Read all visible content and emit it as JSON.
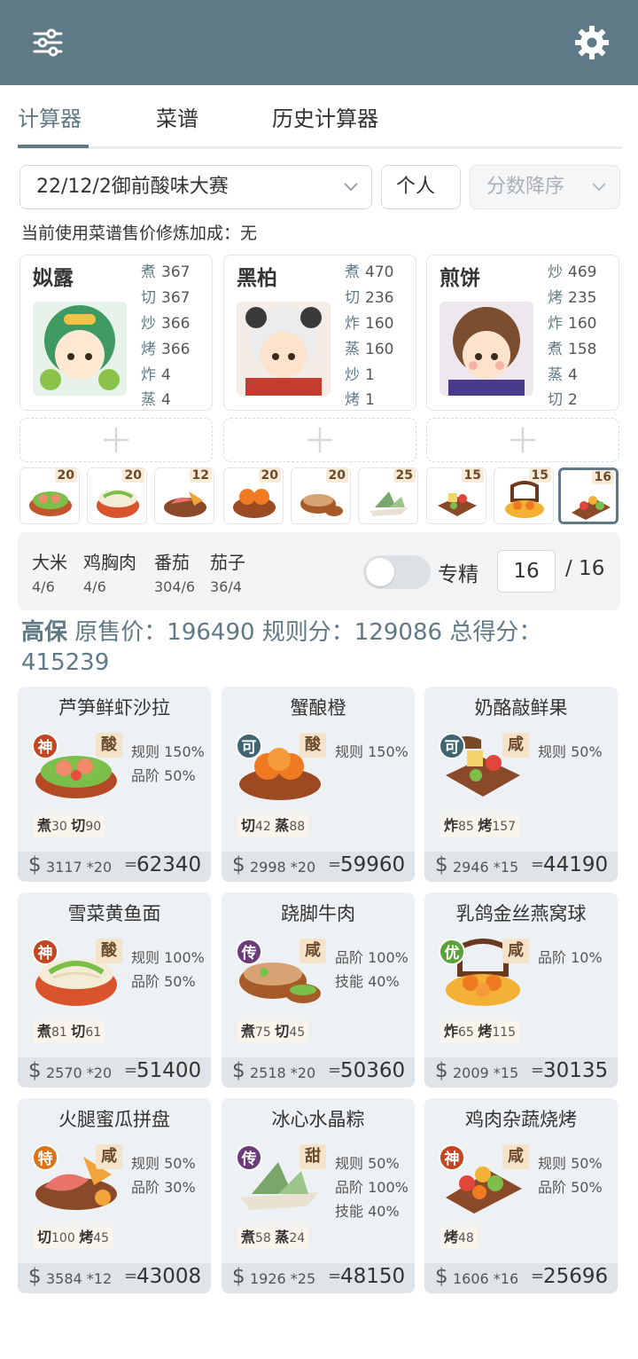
{
  "header": {
    "filter_icon": "sliders-icon",
    "settings_icon": "gear-icon"
  },
  "tabs": [
    {
      "label": "计算器",
      "active": true
    },
    {
      "label": "菜谱",
      "active": false
    },
    {
      "label": "历史计算器",
      "active": false
    }
  ],
  "controls": {
    "event_select": "22/12/2御前酸味大赛",
    "mode_select": "个人",
    "sort_select": "分数降序"
  },
  "bonus_text": "当前使用菜谱售价修炼加成：无",
  "chefs": [
    {
      "name": "姒露",
      "skills": [
        {
          "k": "煮",
          "v": "367"
        },
        {
          "k": "切",
          "v": "367"
        },
        {
          "k": "炒",
          "v": "366"
        },
        {
          "k": "烤",
          "v": "366"
        },
        {
          "k": "炸",
          "v": "4"
        },
        {
          "k": "蒸",
          "v": "4"
        }
      ]
    },
    {
      "name": "黑柏",
      "skills": [
        {
          "k": "煮",
          "v": "470"
        },
        {
          "k": "切",
          "v": "236"
        },
        {
          "k": "炸",
          "v": "160"
        },
        {
          "k": "蒸",
          "v": "160"
        },
        {
          "k": "炒",
          "v": "1"
        },
        {
          "k": "烤",
          "v": "1"
        }
      ]
    },
    {
      "name": "煎饼",
      "skills": [
        {
          "k": "炒",
          "v": "469"
        },
        {
          "k": "烤",
          "v": "235"
        },
        {
          "k": "炸",
          "v": "160"
        },
        {
          "k": "煮",
          "v": "158"
        },
        {
          "k": "蒸",
          "v": "4"
        },
        {
          "k": "切",
          "v": "2"
        }
      ]
    }
  ],
  "thumbs": [
    "20",
    "20",
    "12",
    "20",
    "20",
    "25",
    "15",
    "15",
    "16"
  ],
  "ingredients": [
    {
      "name": "大米",
      "val": "4/6"
    },
    {
      "name": "鸡胸肉",
      "val": "4/6"
    },
    {
      "name": "番茄",
      "val": "304/6"
    },
    {
      "name": "茄子",
      "val": "36/4"
    }
  ],
  "specialize": {
    "label": "专精",
    "on": false,
    "count": "16",
    "total": "/ 16"
  },
  "summary": {
    "name": "高保",
    "text": " 原售价：196490 规则分：129086 总得分：415239"
  },
  "colors": {
    "accent": "#5f7a86",
    "shen": "#c2461f",
    "ke": "#3f6670",
    "chuan": "#6b3a78",
    "you": "#5aa33a",
    "te": "#d9741a"
  },
  "dishes": [
    {
      "title": "芦笋鲜虾沙拉",
      "rarity": "神",
      "rarity_color": "#c2461f",
      "taste": "酸",
      "buffs": [
        "规则 150%",
        "品阶 50%"
      ],
      "reqs": [
        {
          "k": "煮",
          "v": "30"
        },
        {
          "k": "切",
          "v": "90"
        }
      ],
      "price": "3117 *20",
      "total": "62340",
      "icon": "salad-icon"
    },
    {
      "title": "蟹酿橙",
      "rarity": "可",
      "rarity_color": "#3f6670",
      "taste": "酸",
      "buffs": [
        "规则 150%"
      ],
      "reqs": [
        {
          "k": "切",
          "v": "42"
        },
        {
          "k": "蒸",
          "v": "88"
        }
      ],
      "price": "2998 *20",
      "total": "59960",
      "icon": "crab-orange-icon"
    },
    {
      "title": "奶酪敲鲜果",
      "rarity": "可",
      "rarity_color": "#3f6670",
      "taste": "咸",
      "buffs": [
        "规则 50%"
      ],
      "reqs": [
        {
          "k": "炸",
          "v": "85"
        },
        {
          "k": "烤",
          "v": "157"
        }
      ],
      "price": "2946 *15",
      "total": "44190",
      "icon": "cheese-fruit-icon"
    },
    {
      "title": "雪菜黄鱼面",
      "rarity": "神",
      "rarity_color": "#c2461f",
      "taste": "酸",
      "buffs": [
        "规则 100%",
        "品阶 50%"
      ],
      "reqs": [
        {
          "k": "煮",
          "v": "81"
        },
        {
          "k": "切",
          "v": "61"
        }
      ],
      "price": "2570 *20",
      "total": "51400",
      "icon": "noodle-bowl-icon"
    },
    {
      "title": "跷脚牛肉",
      "rarity": "传",
      "rarity_color": "#6b3a78",
      "taste": "咸",
      "buffs": [
        "品阶 100%",
        "技能 40%"
      ],
      "reqs": [
        {
          "k": "煮",
          "v": "75"
        },
        {
          "k": "切",
          "v": "45"
        }
      ],
      "price": "2518 *20",
      "total": "50360",
      "icon": "beef-soup-icon"
    },
    {
      "title": "乳鸽金丝燕窝球",
      "rarity": "优",
      "rarity_color": "#5aa33a",
      "taste": "咸",
      "buffs": [
        "品阶 10%"
      ],
      "reqs": [
        {
          "k": "炸",
          "v": "65"
        },
        {
          "k": "烤",
          "v": "115"
        }
      ],
      "price": "2009 *15",
      "total": "30135",
      "icon": "pigeon-ball-icon"
    },
    {
      "title": "火腿蜜瓜拼盘",
      "rarity": "特",
      "rarity_color": "#d9741a",
      "taste": "咸",
      "buffs": [
        "规则 50%",
        "品阶 30%"
      ],
      "reqs": [
        {
          "k": "切",
          "v": "100"
        },
        {
          "k": "烤",
          "v": "45"
        }
      ],
      "price": "3584 *12",
      "total": "43008",
      "icon": "ham-melon-icon"
    },
    {
      "title": "冰心水晶粽",
      "rarity": "传",
      "rarity_color": "#6b3a78",
      "taste": "甜",
      "buffs": [
        "规则 50%",
        "品阶 100%",
        "技能 40%"
      ],
      "reqs": [
        {
          "k": "煮",
          "v": "58"
        },
        {
          "k": "蒸",
          "v": "24"
        }
      ],
      "price": "1926 *25",
      "total": "48150",
      "icon": "zongzi-icon"
    },
    {
      "title": "鸡肉杂蔬烧烤",
      "rarity": "神",
      "rarity_color": "#c2461f",
      "taste": "咸",
      "buffs": [
        "规则 50%",
        "品阶 50%"
      ],
      "reqs": [
        {
          "k": "烤",
          "v": "48"
        }
      ],
      "price": "1606 *16",
      "total": "25696",
      "icon": "skewer-icon"
    }
  ]
}
